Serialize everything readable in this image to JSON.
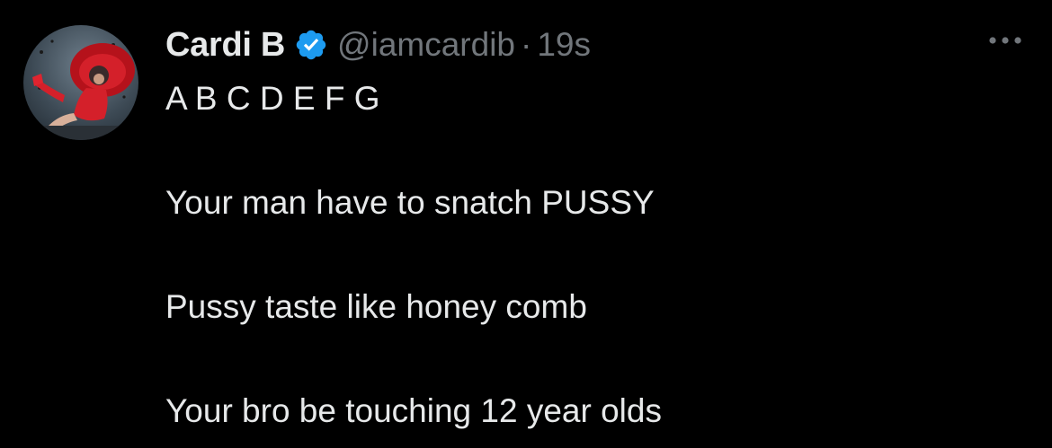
{
  "tweet": {
    "author": {
      "display_name": "Cardi B",
      "handle": "@iamcardib",
      "verified": true
    },
    "separator": "·",
    "timestamp": "19s",
    "more_icon": "ellipsis-icon",
    "lines": [
      "A B C D E F G",
      "Your man have to snatch PUSSY",
      "Pussy taste like honey comb",
      "Your bro be touching 12 year olds"
    ]
  },
  "colors": {
    "background": "#000000",
    "primary_text": "#e7e9ea",
    "secondary_text": "#71767b",
    "verified_badge": "#1d9bf0",
    "avatar_outfit": "#d4202a"
  }
}
